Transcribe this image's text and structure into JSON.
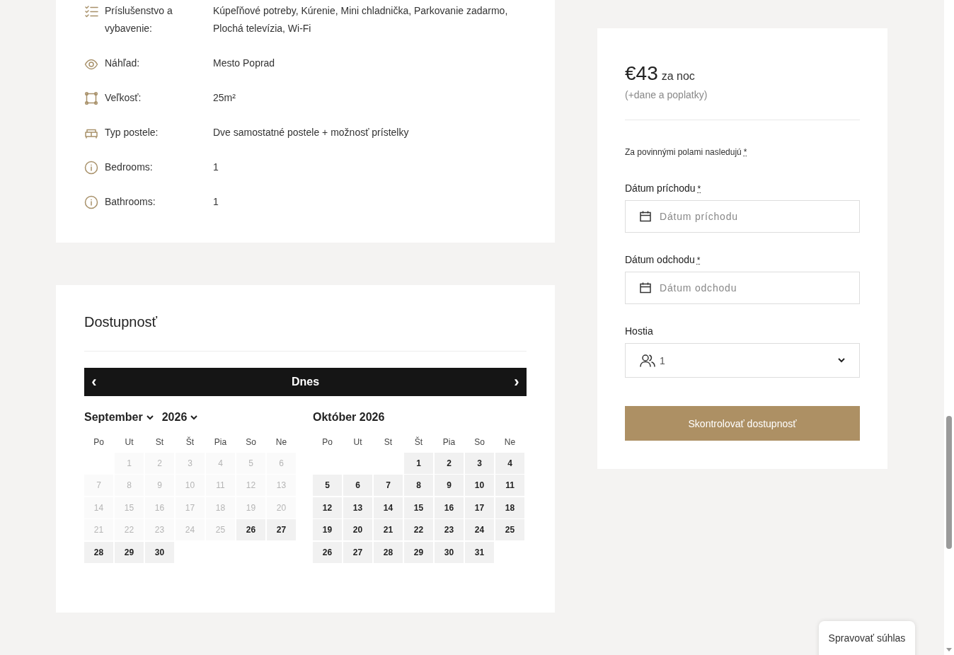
{
  "details": [
    {
      "kind": "checklist",
      "label": "Príslušenstvo a vybavenie:",
      "value": "Kúpeľňové potreby, Kúrenie, Mini chladnička, Parkovanie zadarmo, Plochá televízia, Wi-Fi"
    },
    {
      "kind": "eye",
      "label": "Náhľad:",
      "value": "Mesto Poprad"
    },
    {
      "kind": "size",
      "label": "Veľkosť:",
      "value": "25m²"
    },
    {
      "kind": "bed",
      "label": "Typ postele:",
      "value": "Dve samostatné postele + možnosť prístelky"
    },
    {
      "kind": "info",
      "label": "Bedrooms:",
      "value": "1"
    },
    {
      "kind": "info",
      "label": "Bathrooms:",
      "value": "1"
    }
  ],
  "availability": {
    "title": "Dostupnosť",
    "nav": {
      "prev": "‹",
      "today": "Dnes",
      "next": "›"
    },
    "months": [
      {
        "kind": "select",
        "month": "September",
        "year": "2026",
        "weekdays": [
          "Po",
          "Ut",
          "St",
          "Št",
          "Pia",
          "So",
          "Ne"
        ],
        "days": [
          {
            "kind": "blank"
          },
          {
            "kind": "day",
            "label": "1",
            "disabled": true
          },
          {
            "kind": "day",
            "label": "2",
            "disabled": true
          },
          {
            "kind": "day",
            "label": "3",
            "disabled": true
          },
          {
            "kind": "day",
            "label": "4",
            "disabled": true
          },
          {
            "kind": "day",
            "label": "5",
            "disabled": true
          },
          {
            "kind": "day",
            "label": "6",
            "disabled": true
          },
          {
            "kind": "day",
            "label": "7",
            "disabled": true
          },
          {
            "kind": "day",
            "label": "8",
            "disabled": true
          },
          {
            "kind": "day",
            "label": "9",
            "disabled": true
          },
          {
            "kind": "day",
            "label": "10",
            "disabled": true
          },
          {
            "kind": "day",
            "label": "11",
            "disabled": true
          },
          {
            "kind": "day",
            "label": "12",
            "disabled": true
          },
          {
            "kind": "day",
            "label": "13",
            "disabled": true
          },
          {
            "kind": "day",
            "label": "14",
            "disabled": true
          },
          {
            "kind": "day",
            "label": "15",
            "disabled": true
          },
          {
            "kind": "day",
            "label": "16",
            "disabled": true
          },
          {
            "kind": "day",
            "label": "17",
            "disabled": true
          },
          {
            "kind": "day",
            "label": "18",
            "disabled": true
          },
          {
            "kind": "day",
            "label": "19",
            "disabled": true
          },
          {
            "kind": "day",
            "label": "20",
            "disabled": true
          },
          {
            "kind": "day",
            "label": "21",
            "disabled": true
          },
          {
            "kind": "day",
            "label": "22",
            "disabled": true
          },
          {
            "kind": "day",
            "label": "23",
            "disabled": true
          },
          {
            "kind": "day",
            "label": "24",
            "disabled": true
          },
          {
            "kind": "day",
            "label": "25",
            "disabled": true
          },
          {
            "kind": "day",
            "label": "26",
            "disabled": false
          },
          {
            "kind": "day",
            "label": "27",
            "disabled": false
          },
          {
            "kind": "day",
            "label": "28",
            "disabled": false
          },
          {
            "kind": "day",
            "label": "29",
            "disabled": false
          },
          {
            "kind": "day",
            "label": "30",
            "disabled": false
          }
        ]
      },
      {
        "kind": "title",
        "title": "Október 2026",
        "weekdays": [
          "Po",
          "Ut",
          "St",
          "Št",
          "Pia",
          "So",
          "Ne"
        ],
        "days": [
          {
            "kind": "blank"
          },
          {
            "kind": "blank"
          },
          {
            "kind": "blank"
          },
          {
            "kind": "day",
            "label": "1",
            "disabled": false
          },
          {
            "kind": "day",
            "label": "2",
            "disabled": false
          },
          {
            "kind": "day",
            "label": "3",
            "disabled": false
          },
          {
            "kind": "day",
            "label": "4",
            "disabled": false
          },
          {
            "kind": "day",
            "label": "5",
            "disabled": false
          },
          {
            "kind": "day",
            "label": "6",
            "disabled": false
          },
          {
            "kind": "day",
            "label": "7",
            "disabled": false
          },
          {
            "kind": "day",
            "label": "8",
            "disabled": false
          },
          {
            "kind": "day",
            "label": "9",
            "disabled": false
          },
          {
            "kind": "day",
            "label": "10",
            "disabled": false
          },
          {
            "kind": "day",
            "label": "11",
            "disabled": false
          },
          {
            "kind": "day",
            "label": "12",
            "disabled": false
          },
          {
            "kind": "day",
            "label": "13",
            "disabled": false
          },
          {
            "kind": "day",
            "label": "14",
            "disabled": false
          },
          {
            "kind": "day",
            "label": "15",
            "disabled": false
          },
          {
            "kind": "day",
            "label": "16",
            "disabled": false
          },
          {
            "kind": "day",
            "label": "17",
            "disabled": false
          },
          {
            "kind": "day",
            "label": "18",
            "disabled": false
          },
          {
            "kind": "day",
            "label": "19",
            "disabled": false
          },
          {
            "kind": "day",
            "label": "20",
            "disabled": false
          },
          {
            "kind": "day",
            "label": "21",
            "disabled": false
          },
          {
            "kind": "day",
            "label": "22",
            "disabled": false
          },
          {
            "kind": "day",
            "label": "23",
            "disabled": false
          },
          {
            "kind": "day",
            "label": "24",
            "disabled": false
          },
          {
            "kind": "day",
            "label": "25",
            "disabled": false
          },
          {
            "kind": "day",
            "label": "26",
            "disabled": false
          },
          {
            "kind": "day",
            "label": "27",
            "disabled": false
          },
          {
            "kind": "day",
            "label": "28",
            "disabled": false
          },
          {
            "kind": "day",
            "label": "29",
            "disabled": false
          },
          {
            "kind": "day",
            "label": "30",
            "disabled": false
          },
          {
            "kind": "day",
            "label": "31",
            "disabled": false
          }
        ]
      }
    ]
  },
  "booking": {
    "price": "€43",
    "per": "za noc",
    "taxes": "(+dane a poplatky)",
    "required_note": "Za povinnými polami nasledujú",
    "required_mark": "*",
    "fields": [
      {
        "kind": "date",
        "label": "Dátum príchodu",
        "required": true,
        "placeholder": "Dátum príchodu"
      },
      {
        "kind": "date",
        "label": "Dátum odchodu",
        "required": true,
        "placeholder": "Dátum odchodu"
      },
      {
        "kind": "guests",
        "label": "Hostia",
        "required": false,
        "value": "1"
      }
    ],
    "button": "Skontrolovať dostupnosť"
  },
  "consent_button": "Spravovať súhlas"
}
